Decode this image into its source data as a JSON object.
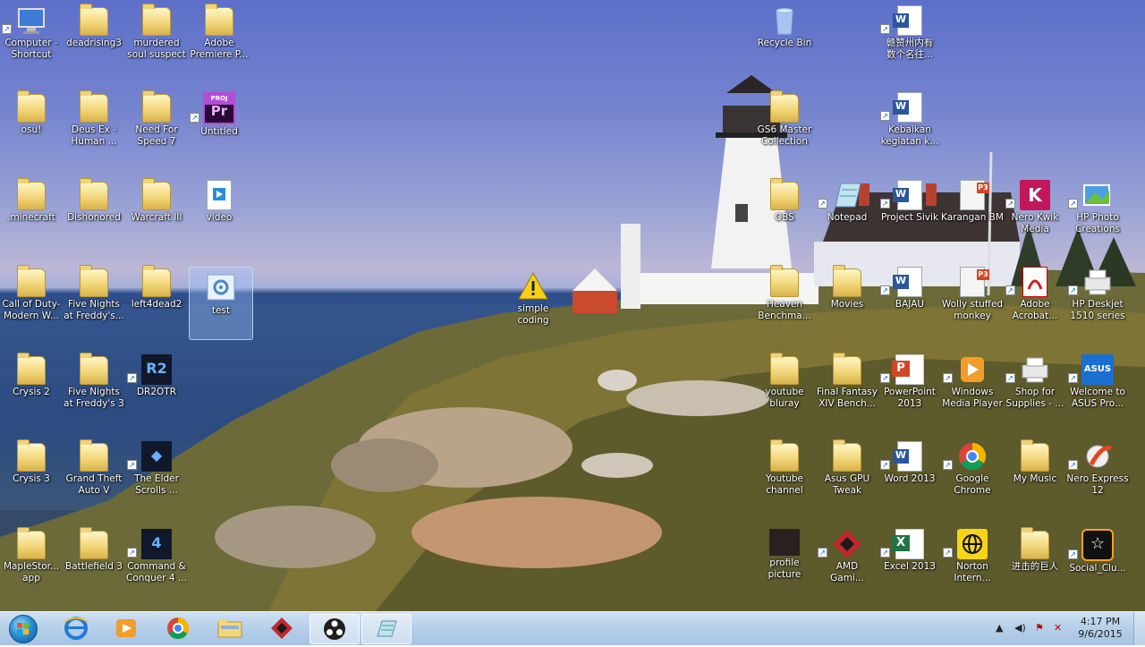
{
  "desktop_icons": [
    {
      "label": "Computer -\nShortcut",
      "type": "computer"
    },
    {
      "label": "deadrising3",
      "type": "folder"
    },
    {
      "label": "murdered\nsoul suspect",
      "type": "folder"
    },
    {
      "label": "Adobe\nPremiere P...",
      "type": "folder"
    },
    {
      "label": "osu!",
      "type": "folder"
    },
    {
      "label": "Deus Ex -\nHuman ...",
      "type": "folder"
    },
    {
      "label": "Need For\nSpeed 7",
      "type": "folder"
    },
    {
      "label": "Untitled",
      "type": "premiere",
      "badge": "Pr",
      "badge_top": "PROJ"
    },
    {
      "label": ".minecraft",
      "type": "folder"
    },
    {
      "label": "Dishonored",
      "type": "folder"
    },
    {
      "label": "Warcraft III",
      "type": "folder"
    },
    {
      "label": "video",
      "type": "media"
    },
    {
      "label": "Call of Duty-\nModern W...",
      "type": "folder"
    },
    {
      "label": "Five Nights\nat Freddy's...",
      "type": "folder"
    },
    {
      "label": "left4dead2",
      "type": "folder"
    },
    {
      "label": "test",
      "type": "settings",
      "selected": true
    },
    {
      "label": "Crysis 2",
      "type": "folder"
    },
    {
      "label": "Five Nights\nat Freddy's 3",
      "type": "folder"
    },
    {
      "label": "DR2OTR",
      "type": "game",
      "badge": "R2"
    },
    {
      "label": "Crysis 3",
      "type": "folder"
    },
    {
      "label": "Grand Theft\nAuto V",
      "type": "folder"
    },
    {
      "label": "The Elder\nScrolls ...",
      "type": "game"
    },
    {
      "label": "MapleStor...\napp",
      "type": "folder"
    },
    {
      "label": "Battlefield 3",
      "type": "folder"
    },
    {
      "label": "Command &\nConquer 4 ...",
      "type": "game",
      "badge": "4"
    },
    {
      "label": "simple\ncoding",
      "type": "warning"
    },
    {
      "label": "Recycle Bin",
      "type": "recycle"
    },
    {
      "label": "GS6 Master\nCollection",
      "type": "folder"
    },
    {
      "label": "OBS",
      "type": "folder"
    },
    {
      "label": "Heaven\nBenchma...",
      "type": "folder"
    },
    {
      "label": "youtube\nbluray",
      "type": "folder"
    },
    {
      "label": "Youtube\nchannel",
      "type": "folder"
    },
    {
      "label": "profile\npicture",
      "type": "image"
    },
    {
      "label": "Movies",
      "type": "folder"
    },
    {
      "label": "Final Fantasy\nXIV Bench...",
      "type": "folder"
    },
    {
      "label": "Asus GPU\nTweak",
      "type": "folder"
    },
    {
      "label": "AMD\nGami...",
      "type": "amd"
    },
    {
      "label": "Notepad",
      "type": "notepad"
    },
    {
      "label": "赣赞州内有\n数个名往...",
      "type": "word",
      "badge": "W"
    },
    {
      "label": "Kebaikan\nkegiatan k...",
      "type": "word",
      "badge": "W"
    },
    {
      "label": "Project Sivik",
      "type": "word",
      "badge": "W"
    },
    {
      "label": "BAJAU",
      "type": "word",
      "badge": "W"
    },
    {
      "label": "PowerPoint\n2013",
      "type": "powerpoint",
      "badge": "P"
    },
    {
      "label": "Word 2013",
      "type": "word",
      "badge": "W"
    },
    {
      "label": "Excel 2013",
      "type": "excel",
      "badge": "X"
    },
    {
      "label": "Karangan BM",
      "type": "ppt-file",
      "badge": "P3"
    },
    {
      "label": "Wolly stuffed\nmonkey",
      "type": "ppt-file",
      "badge": "P3"
    },
    {
      "label": "Windows\nMedia Player",
      "type": "wmp"
    },
    {
      "label": "Google\nChrome",
      "type": "chrome"
    },
    {
      "label": "Norton\nIntern...",
      "type": "norton"
    },
    {
      "label": "Nero Kwik\nMedia",
      "type": "nero",
      "badge": "K"
    },
    {
      "label": "Adobe\nAcrobat...",
      "type": "acrobat"
    },
    {
      "label": "Shop for\nSupplies - ...",
      "type": "printer"
    },
    {
      "label": "My Music",
      "type": "folder"
    },
    {
      "label": "进击的巨人",
      "type": "folder"
    },
    {
      "label": "HP Photo\nCreations",
      "type": "photo"
    },
    {
      "label": "HP Deskjet\n1510 series",
      "type": "printer"
    },
    {
      "label": "Welcome to\nASUS Pro...",
      "type": "asus",
      "badge": "ASUS"
    },
    {
      "label": "Nero Express\n12",
      "type": "nero-express"
    },
    {
      "label": "Social_Clu...",
      "type": "social"
    }
  ],
  "taskbar": {
    "apps": [
      {
        "name": "internet-explorer"
      },
      {
        "name": "windows-media-player"
      },
      {
        "name": "google-chrome"
      },
      {
        "name": "windows-explorer"
      },
      {
        "name": "amd-gaming"
      },
      {
        "name": "obs",
        "active": true
      },
      {
        "name": "notepad",
        "active": true
      }
    ],
    "clock_time": "4:17 PM",
    "clock_date": "9/6/2015"
  }
}
